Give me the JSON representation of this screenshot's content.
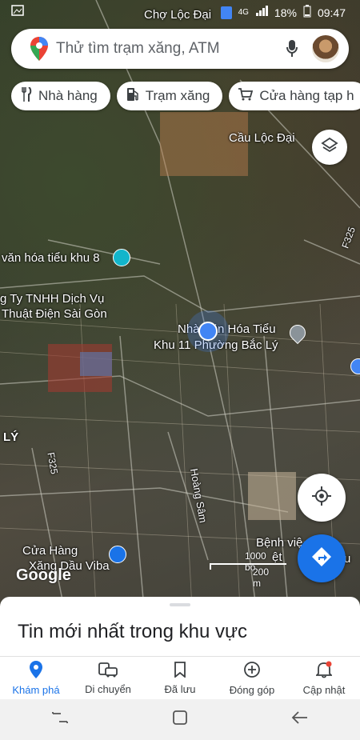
{
  "status_bar": {
    "network": "4G",
    "battery": "18%",
    "time": "09:47"
  },
  "search": {
    "placeholder": "Thử tìm trạm xăng, ATM"
  },
  "chips": [
    {
      "label": "Nhà hàng",
      "icon": "fork-knife-icon"
    },
    {
      "label": "Trạm xăng",
      "icon": "gas-station-icon"
    },
    {
      "label": "Cửa hàng tạp h",
      "icon": "cart-icon"
    }
  ],
  "map_labels": {
    "cho_loc_dai": "Chợ Lộc Đại",
    "cau_loc_dai": "Cầu Lộc Đại",
    "van_hoa_khu8": "văn hóa tiểu khu 8",
    "cong_ty_line1": "g Ty TNHH Dịch Vụ",
    "cong_ty_line2": "Thuật Điện Sài Gòn",
    "nha_van_hoa_line1": "Nhà Văn Hóa Tiểu",
    "nha_van_hoa_line2": "Khu 11 Phường Bắc Lý",
    "ly": "LÝ",
    "f325_left": "F325",
    "f325_right": "F325",
    "hoang_sam": "Hoàng Sâm",
    "cua_hang_line1": "Cửa Hàng",
    "cua_hang_line2": "Xăng Dầu Viba",
    "benh_vien": "Bệnh việ",
    "benh_vien_2": "ệt",
    "benh_vien_3": "u"
  },
  "scale": {
    "ft": "1000 bộ",
    "m": "200 m"
  },
  "google_logo": "Google",
  "sheet": {
    "title": "Tin mới nhất trong khu vực"
  },
  "bottom_nav": [
    {
      "label": "Khám phá",
      "icon": "explore-pin-icon",
      "active": true
    },
    {
      "label": "Di chuyển",
      "icon": "commute-icon",
      "active": false
    },
    {
      "label": "Đã lưu",
      "icon": "bookmark-icon",
      "active": false
    },
    {
      "label": "Đóng góp",
      "icon": "add-circle-icon",
      "active": false
    },
    {
      "label": "Cập nhật",
      "icon": "bell-icon",
      "active": false
    }
  ],
  "colors": {
    "accent": "#1a73e8",
    "location_dot": "#4285f4"
  }
}
